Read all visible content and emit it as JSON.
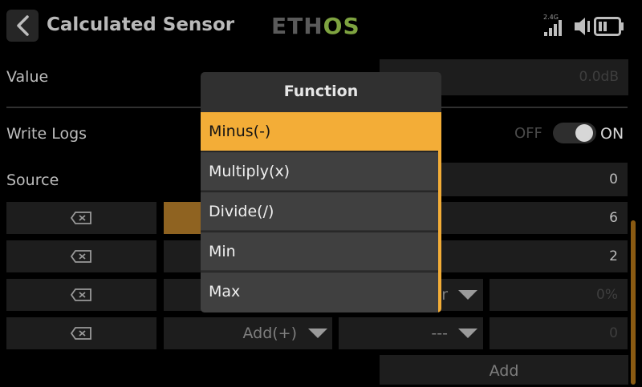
{
  "header": {
    "title": "Calculated Sensor",
    "logo_eth": "ETH",
    "logo_os": "OS",
    "rf_band": "2.4G"
  },
  "form": {
    "value_label": "Value",
    "value_value": "0.0dB",
    "write_logs_label": "Write Logs",
    "write_logs_off": "OFF",
    "write_logs_on": "ON",
    "write_logs_enabled": true,
    "source_label": "Source",
    "source_value": "0",
    "rows": [
      {
        "value": "6"
      },
      {
        "value": "2"
      },
      {
        "dd_tail": "r",
        "value": "0%"
      },
      {
        "function": "Add(+)",
        "source": "---",
        "value": "0"
      }
    ],
    "add_label": "Add"
  },
  "popup": {
    "title": "Function",
    "options": [
      "Minus(-)",
      "Multiply(x)",
      "Divide(/)",
      "Min",
      "Max"
    ],
    "selected_index": 0
  },
  "colors": {
    "accent": "#f3ad37",
    "background": "#000000",
    "popup_bg": "#303030",
    "logo_green": "#7ea340"
  }
}
